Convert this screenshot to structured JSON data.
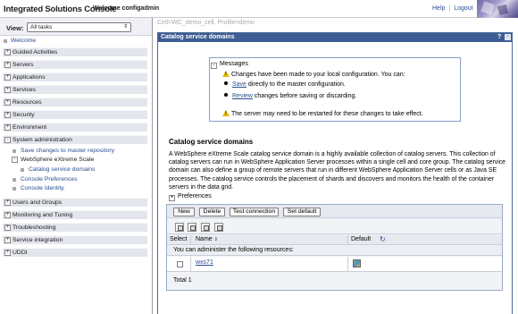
{
  "banner": {
    "title": "Integrated Solutions Console",
    "welcome": "Welcome configadmin",
    "help": "Help",
    "separator": "|",
    "logout": "Logout"
  },
  "nav": {
    "view_label": "View:",
    "view_value": "All tasks",
    "welcome": "Welcome",
    "categories": [
      {
        "label": "Guided Activities",
        "state": "+"
      },
      {
        "label": "Servers",
        "state": "+"
      },
      {
        "label": "Applications",
        "state": "+"
      },
      {
        "label": "Services",
        "state": "+"
      },
      {
        "label": "Resources",
        "state": "+"
      },
      {
        "label": "Security",
        "state": "+"
      },
      {
        "label": "Environment",
        "state": "+"
      },
      {
        "label": "System administration",
        "state": "-"
      },
      {
        "label": "Users and Groups",
        "state": "+"
      },
      {
        "label": "Monitoring and Tuning",
        "state": "+"
      },
      {
        "label": "Troubleshooting",
        "state": "+"
      },
      {
        "label": "Service integration",
        "state": "+"
      },
      {
        "label": "UDDI",
        "state": "+"
      }
    ],
    "sub": {
      "save_changes": "Save changes to master repository",
      "websphere_xs": "WebSphere eXtreme Scale",
      "catalog_domains": "Catalog service domains",
      "console_prefs": "Console Preferences",
      "console_identity": "Console Identity",
      "expander": "-"
    }
  },
  "content": {
    "cell_line": "Cell=WC_demo_cell, Profile=demo",
    "panel_title": "Catalog service domains",
    "help_q": "?",
    "min": "-",
    "messages": {
      "header": "Messages",
      "expander": "-",
      "line1": "Changes have been made to your local configuration. You can:",
      "save_link": "Save",
      "save_rest": " directly to the master configuration.",
      "review_link": "Review",
      "review_rest": " changes before saving or discarding.",
      "restart": "The server may need to be restarted for these changes to take effect."
    },
    "section_title": "Catalog service domains",
    "description": "A WebSphere eXtreme Scale catalog service domain is a highly available collection of catalog servers. This collection of catalog servers can run in WebSphere Application Server processes within a single cell and core group. The catalog service domain can also define a group of remote servers that run in different WebSphere Application Server cells or as Java SE processes. The catalog service controls the placement of shards and discovers and monitors the health of the container servers in the data grid.",
    "preferences": "Preferences",
    "preferences_expander": "+",
    "buttons": {
      "new": "New",
      "delete": "Delete",
      "test": "Test connection",
      "set_default": "Set default"
    },
    "table": {
      "col_select": "Select",
      "col_name": "Name",
      "col_default": "Default",
      "sort_glyph": "⇕",
      "admin_note": "You can administer the following resources:",
      "rows": [
        {
          "name": "wxs71"
        }
      ],
      "total": "Total 1"
    }
  }
}
